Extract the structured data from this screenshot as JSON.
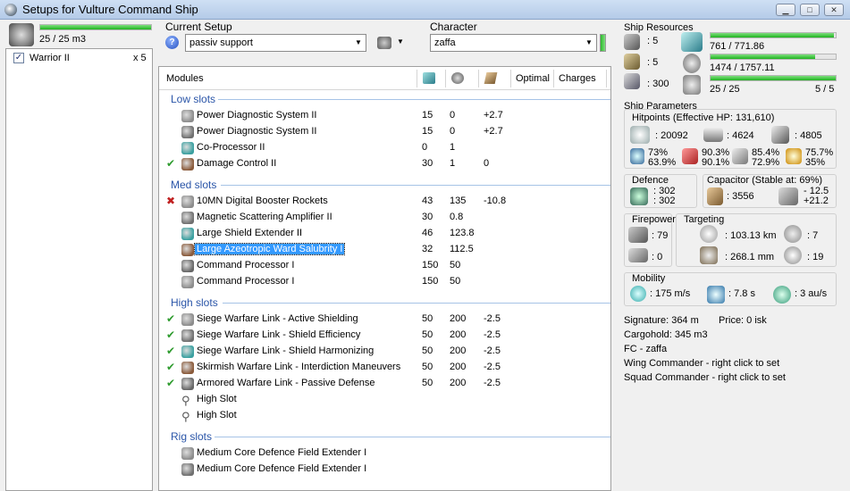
{
  "window": {
    "title": "Setups for Vulture Command Ship"
  },
  "left": {
    "drone_bay_usage": "25 / 25 m3",
    "drone_bay_fill": 1.0,
    "drones": [
      {
        "checked": true,
        "name": "Warrior II",
        "qty": "x 5"
      }
    ]
  },
  "setup": {
    "current_label": "Current Setup",
    "current_value": "passiv support",
    "character_label": "Character",
    "character_value": "zaffa"
  },
  "modules": {
    "headers": {
      "modules": "Modules",
      "optimal": "Optimal",
      "charges": "Charges"
    },
    "low_title": "Low slots",
    "low": [
      {
        "status": "",
        "name": "Power Diagnostic System II",
        "a": "15",
        "b": "0",
        "c": "+2.7"
      },
      {
        "status": "",
        "name": "Power Diagnostic System II",
        "a": "15",
        "b": "0",
        "c": "+2.7"
      },
      {
        "status": "",
        "name": "Co-Processor II",
        "a": "0",
        "b": "1",
        "c": ""
      },
      {
        "status": "✔",
        "name": "Damage Control II",
        "a": "30",
        "b": "1",
        "c": "0"
      }
    ],
    "med_title": "Med slots",
    "med": [
      {
        "status": "✖",
        "name": "10MN Digital Booster Rockets",
        "a": "43",
        "b": "135",
        "c": "-10.8"
      },
      {
        "status": "",
        "name": "Magnetic Scattering Amplifier II",
        "a": "30",
        "b": "0.8",
        "c": ""
      },
      {
        "status": "",
        "name": "Large Shield Extender II",
        "a": "46",
        "b": "123.8",
        "c": ""
      },
      {
        "status": "",
        "name": "Large Azeotropic Ward Salubrity I",
        "a": "32",
        "b": "112.5",
        "c": ""
      },
      {
        "status": "",
        "name": "Command Processor I",
        "a": "150",
        "b": "50",
        "c": ""
      },
      {
        "status": "",
        "name": "Command Processor I",
        "a": "150",
        "b": "50",
        "c": ""
      }
    ],
    "high_title": "High slots",
    "high": [
      {
        "status": "✔",
        "name": "Siege Warfare Link - Active Shielding",
        "a": "50",
        "b": "200",
        "c": "-2.5"
      },
      {
        "status": "✔",
        "name": "Siege Warfare Link - Shield Efficiency",
        "a": "50",
        "b": "200",
        "c": "-2.5"
      },
      {
        "status": "✔",
        "name": "Siege Warfare Link - Shield Harmonizing",
        "a": "50",
        "b": "200",
        "c": "-2.5"
      },
      {
        "status": "✔",
        "name": "Skirmish Warfare Link - Interdiction Maneuvers",
        "a": "50",
        "b": "200",
        "c": "-2.5"
      },
      {
        "status": "✔",
        "name": "Armored Warfare Link - Passive Defense",
        "a": "50",
        "b": "200",
        "c": "-2.5"
      },
      {
        "status": "",
        "name": "High Slot",
        "a": "",
        "b": "",
        "c": ""
      },
      {
        "status": "",
        "name": "High Slot",
        "a": "",
        "b": "",
        "c": ""
      }
    ],
    "rig_title": "Rig slots",
    "rig": [
      {
        "status": "",
        "name": "Medium Core Defence Field Extender I",
        "a": "",
        "b": "",
        "c": ""
      },
      {
        "status": "",
        "name": "Medium Core Defence Field Extender I",
        "a": "",
        "b": "",
        "c": ""
      }
    ]
  },
  "resources": {
    "title": "Ship Resources",
    "turret": ": 5",
    "launcher": ": 5",
    "calibration": ": 300",
    "cpu": "761 / 771.86",
    "cpu_fill": 0.986,
    "power": "1474 / 1757.11",
    "power_fill": 0.839,
    "drone_bw": "25 / 25",
    "drone_count": "5 / 5",
    "drone_bw_fill": 1.0
  },
  "params": {
    "title": "Ship Parameters",
    "hp_title": "Hitpoints (Effective HP: 131,610)",
    "shield_hp": ": 20092",
    "armor_hp": ": 4624",
    "hull_hp": ": 4805",
    "res_em_shield": "73%",
    "res_em_armor": "63.9%",
    "res_th_shield": "90.3%",
    "res_th_armor": "90.1%",
    "res_ki_shield": "85.4%",
    "res_ki_armor": "72.9%",
    "res_ex_shield": "75.7%",
    "res_ex_armor": "35%",
    "defence_title": "Defence",
    "def_a": ": 302",
    "def_b": ": 302",
    "capacitor_title": "Capacitor (Stable at: 69%)",
    "cap_amount": ": 3556",
    "cap_delta_a": "- 12.5",
    "cap_delta_b": "+21.2",
    "firepower_title": "Firepower",
    "fire_a": ": 79",
    "fire_b": ": 0",
    "targeting_title": "Targeting",
    "tgt_range": ": 103.13 km",
    "tgt_count": ": 7",
    "tgt_scan": ": 268.1 mm",
    "tgt_sensor": ": 19",
    "mobility_title": "Mobility",
    "speed": ": 175 m/s",
    "align": ": 7.8 s",
    "warp": ": 3 au/s"
  },
  "info": {
    "signature": "Signature: 364 m",
    "price": "Price: 0 isk",
    "cargo": "Cargohold: 345 m3",
    "fc": "FC - zaffa",
    "wing": "Wing Commander - right click to set",
    "squad": "Squad Commander - right click to set"
  },
  "colors": {
    "accent": "#2a55a8",
    "ok": "#2e9b2e",
    "bad": "#c02020",
    "bar": "#1fb31f",
    "selection": "#3399ff"
  }
}
